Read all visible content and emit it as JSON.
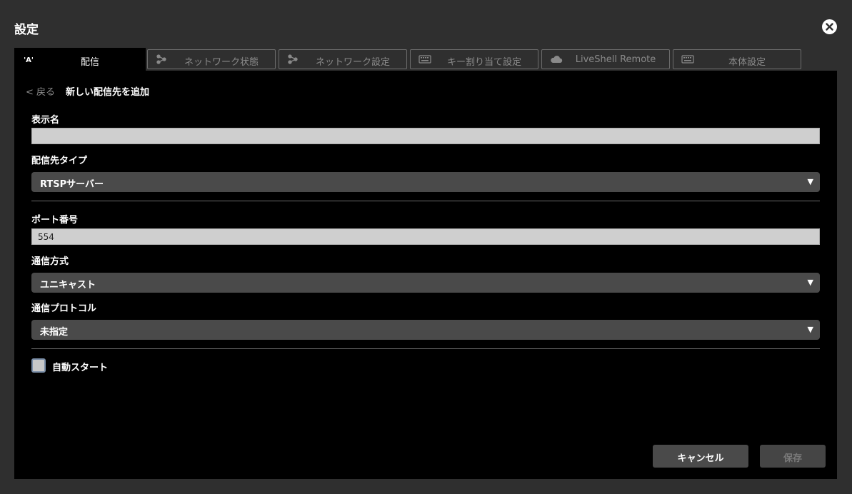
{
  "window": {
    "title": "設定",
    "close_icon": "close-icon"
  },
  "tabs": [
    {
      "label": "配信",
      "icon": "broadcast-icon",
      "active": true
    },
    {
      "label": "ネットワーク状態",
      "icon": "network-share-icon"
    },
    {
      "label": "ネットワーク設定",
      "icon": "network-share-icon"
    },
    {
      "label": "キー割り当て設定",
      "icon": "keyboard-icon"
    },
    {
      "label": "LiveShell Remote",
      "icon": "cloud-icon"
    },
    {
      "label": "本体設定",
      "icon": "keyboard-icon"
    }
  ],
  "nav": {
    "back": "< 戻る",
    "heading": "新しい配信先を追加"
  },
  "form": {
    "display_name": {
      "label": "表示名",
      "value": ""
    },
    "target_type": {
      "label": "配信先タイプ",
      "value": "RTSPサーバー"
    },
    "port": {
      "label": "ポート番号",
      "value": "554"
    },
    "comm_method": {
      "label": "通信方式",
      "value": "ユニキャスト"
    },
    "comm_protocol": {
      "label": "通信プロトコル",
      "value": "未指定"
    },
    "auto_start": {
      "label": "自動スタート",
      "checked": false
    }
  },
  "select_arrow": "▼",
  "buttons": {
    "cancel": "キャンセル",
    "save": "保存"
  },
  "colors": {
    "background": "#2f2f2f",
    "panel": "#000000",
    "input": "#cfcfcf",
    "select": "#4a4a4a"
  }
}
